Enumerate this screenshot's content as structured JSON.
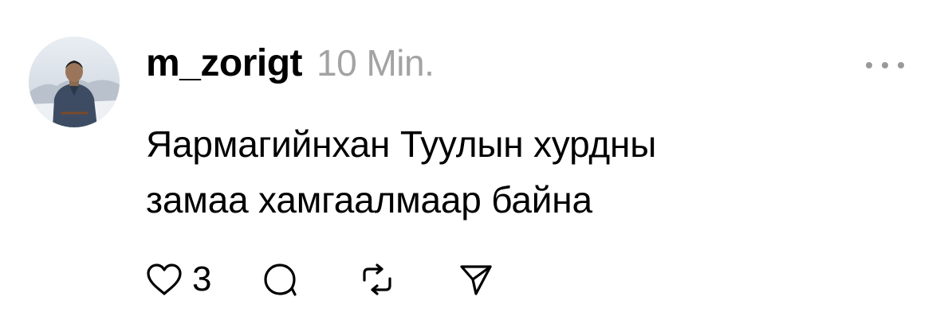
{
  "post": {
    "username": "m_zorigt",
    "timestamp": "10 Min.",
    "text_lines": [
      "Яармагийнхан Туулын хурдны",
      "замаа хамгаалмаар байна"
    ],
    "like_count": "3"
  },
  "icons": {
    "more": "more-horizontal-icon",
    "like": "heart-icon",
    "comment": "speech-bubble-icon",
    "repost": "repost-arrows-icon",
    "share": "paper-plane-icon"
  },
  "colors": {
    "text": "#000000",
    "muted": "#a3a3a3",
    "icon": "#000000",
    "background": "#ffffff"
  }
}
